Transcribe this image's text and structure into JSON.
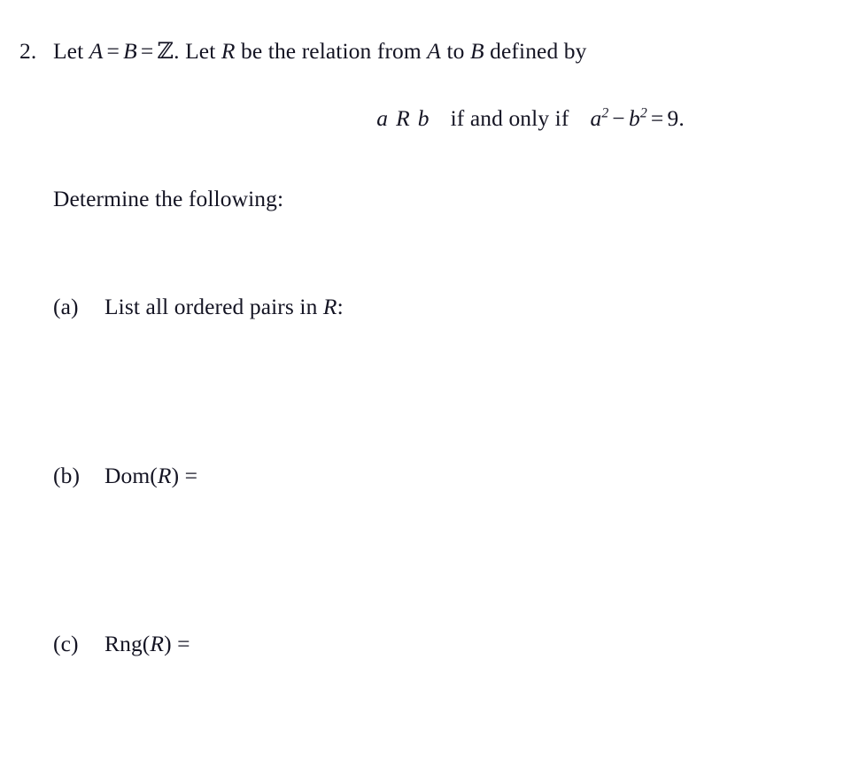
{
  "document": {
    "background_color": "#ffffff",
    "text_color": "#141423"
  },
  "problem": {
    "number": "2.",
    "stem": {
      "part1": "Let ",
      "var_a": "A",
      "eq1": "=",
      "var_b": "B",
      "eq2": "=",
      "set_z": "ℤ",
      "period": ". ",
      "part2": "Let ",
      "var_r": "R",
      "part3": " be the relation from ",
      "var_a2": "A",
      "part4": " to ",
      "var_b2": "B",
      "part5": " defined by"
    },
    "display_equation": {
      "lhs_a": "a",
      "lhs_r": "R",
      "lhs_b": "b",
      "connector": "if and only if",
      "rhs_a": "a",
      "rhs_a_exp": "2",
      "minus": "−",
      "rhs_b": "b",
      "rhs_b_exp": "2",
      "equals": "=",
      "value": "9",
      "period": "."
    },
    "instruction": "Determine the following:",
    "parts": [
      {
        "tag": "(a)",
        "text_before": "List all ordered pairs in ",
        "symbol": "R",
        "text_after": ":",
        "answer": ""
      },
      {
        "tag": "(b)",
        "text_before": "Dom(",
        "symbol": "R",
        "text_after": ") =",
        "answer": ""
      },
      {
        "tag": "(c)",
        "text_before": "Rng(",
        "symbol": "R",
        "text_after": ") =",
        "answer": ""
      }
    ]
  }
}
